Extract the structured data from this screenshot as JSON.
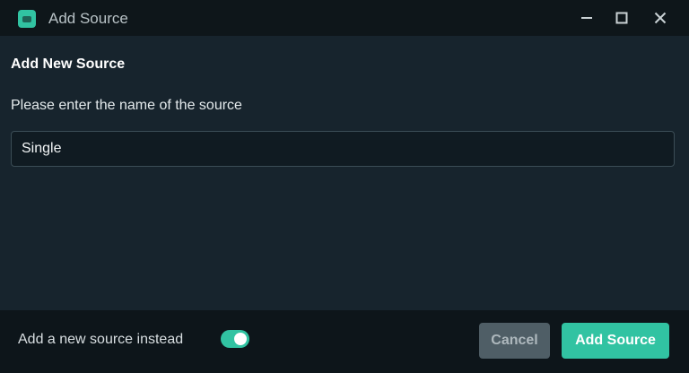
{
  "window": {
    "title": "Add Source",
    "icon": "streamlabs-app-icon",
    "controls": [
      "minimize-icon",
      "maximize-icon",
      "close-icon"
    ]
  },
  "dialog": {
    "heading": "Add New Source",
    "prompt": "Please enter the name of the source",
    "source_name_value": "Single"
  },
  "footer": {
    "toggle_label": "Add a new source instead",
    "toggle_on": true,
    "cancel_label": "Cancel",
    "submit_label": "Add Source"
  },
  "colors": {
    "accent": "#31c3a2",
    "body_background": "#17242d",
    "titlebar_background": "#0e161a",
    "footer_background": "#0d151a",
    "cancel_background": "#4f5e66"
  }
}
